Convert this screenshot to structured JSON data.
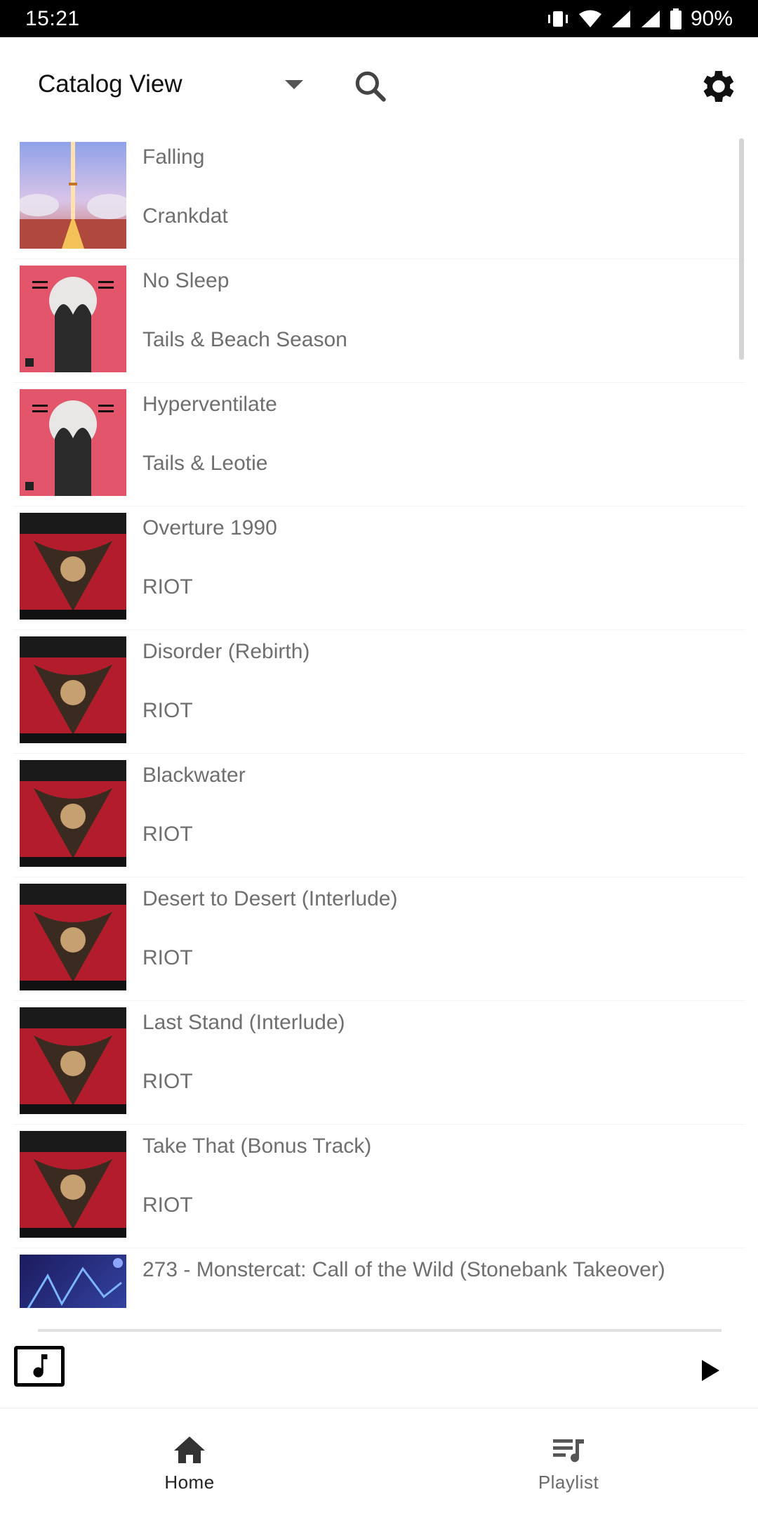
{
  "status_bar": {
    "time": "15:21",
    "battery": "90%",
    "icons": [
      "vibrate-icon",
      "wifi-icon",
      "signal-icon",
      "signal-icon-2",
      "battery-icon"
    ]
  },
  "toolbar": {
    "view_label": "Catalog View",
    "search_icon": "search-icon",
    "settings_icon": "gear-icon"
  },
  "tracks": [
    {
      "title": "Falling",
      "artist": "Crankdat",
      "art": "falling"
    },
    {
      "title": "No Sleep",
      "artist": "Tails & Beach Season",
      "art": "tails"
    },
    {
      "title": "Hyperventilate",
      "artist": "Tails & Leotie",
      "art": "tails"
    },
    {
      "title": "Overture 1990",
      "artist": "RIOT",
      "art": "riot"
    },
    {
      "title": "Disorder (Rebirth)",
      "artist": "RIOT",
      "art": "riot"
    },
    {
      "title": "Blackwater",
      "artist": "RIOT",
      "art": "riot"
    },
    {
      "title": "Desert to Desert (Interlude)",
      "artist": "RIOT",
      "art": "riot"
    },
    {
      "title": "Last Stand (Interlude)",
      "artist": "RIOT",
      "art": "riot"
    },
    {
      "title": "Take That (Bonus Track)",
      "artist": "RIOT",
      "art": "riot"
    },
    {
      "title": "273 - Monstercat: Call of the Wild (Stonebank Takeover)",
      "artist": "",
      "art": "call"
    }
  ],
  "player": {
    "progress": 0,
    "art_icon": "music-note-icon",
    "play_icon": "play-icon"
  },
  "nav": {
    "home_label": "Home",
    "playlist_label": "Playlist",
    "active": "home"
  },
  "colors": {
    "text_secondary": "#6f6f6f",
    "tails_red": "#e2556a",
    "riot_red": "#b31d2b"
  }
}
